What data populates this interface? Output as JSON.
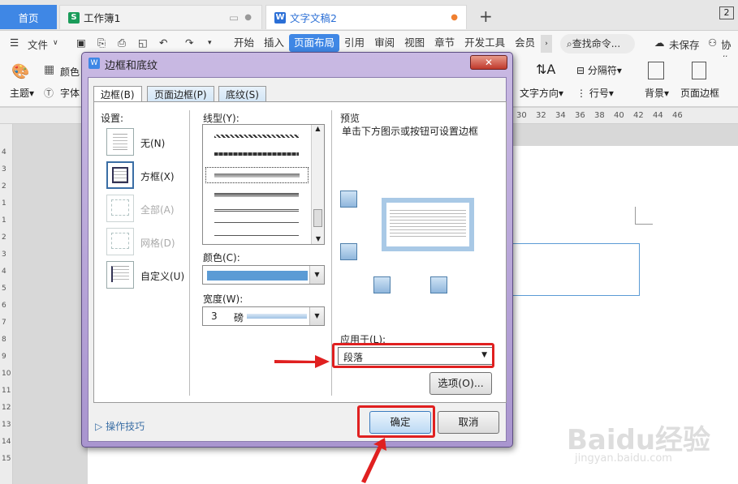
{
  "tabs": {
    "home": "首页",
    "sheet": "工作簿1",
    "doc": "文字文稿2",
    "add": "+",
    "sheet_badge": "S",
    "doc_badge": "W",
    "page_num": "2"
  },
  "toolbar": {
    "file": "文件",
    "menus": [
      "开始",
      "插入",
      "页面布局",
      "引用",
      "审阅",
      "视图",
      "章节",
      "开发工具",
      "会员"
    ],
    "active_menu": "页面布局",
    "search": "查找命令...",
    "unsaved": "未保存",
    "collab": "协作"
  },
  "ribbon": {
    "theme": "主题",
    "color": "颜色",
    "font": "字体",
    "text_dir": "文字方向",
    "columns": "分隔符",
    "line_num": "行号",
    "background": "背景",
    "page_border": "页面边框"
  },
  "ruler": {
    "marks": [
      "30",
      "32",
      "34",
      "36",
      "38",
      "40",
      "42",
      "44",
      "46"
    ],
    "vmarks": [
      "4",
      "3",
      "2",
      "1",
      "1",
      "2",
      "3",
      "4",
      "5",
      "6",
      "7",
      "8",
      "9",
      "10",
      "11",
      "12",
      "13",
      "14",
      "15"
    ]
  },
  "dialog": {
    "title": "边框和底纹",
    "tabs": [
      "边框(B)",
      "页面边框(P)",
      "底纹(S)"
    ],
    "setting_label": "设置:",
    "settings": [
      "无(N)",
      "方框(X)",
      "全部(A)",
      "网格(D)",
      "自定义(U)"
    ],
    "line_style_label": "线型(Y):",
    "color_label": "颜色(C):",
    "width_label": "宽度(W):",
    "width_value": "3",
    "width_unit": "磅",
    "preview_label": "预览",
    "preview_hint": "单击下方图示或按钮可设置边框",
    "apply_label": "应用于(L):",
    "apply_value": "段落",
    "options_button": "选项(O)...",
    "tips": "操作技巧",
    "ok": "确定",
    "cancel": "取消"
  },
  "colors": {
    "accent": "#3f87e5",
    "dialog_frame": "#b8a6d8",
    "highlight": "#e02020",
    "border_color": "#5b9bd5"
  },
  "watermark": {
    "brand": "Baidu经验",
    "url": "jingyan.baidu.com"
  }
}
